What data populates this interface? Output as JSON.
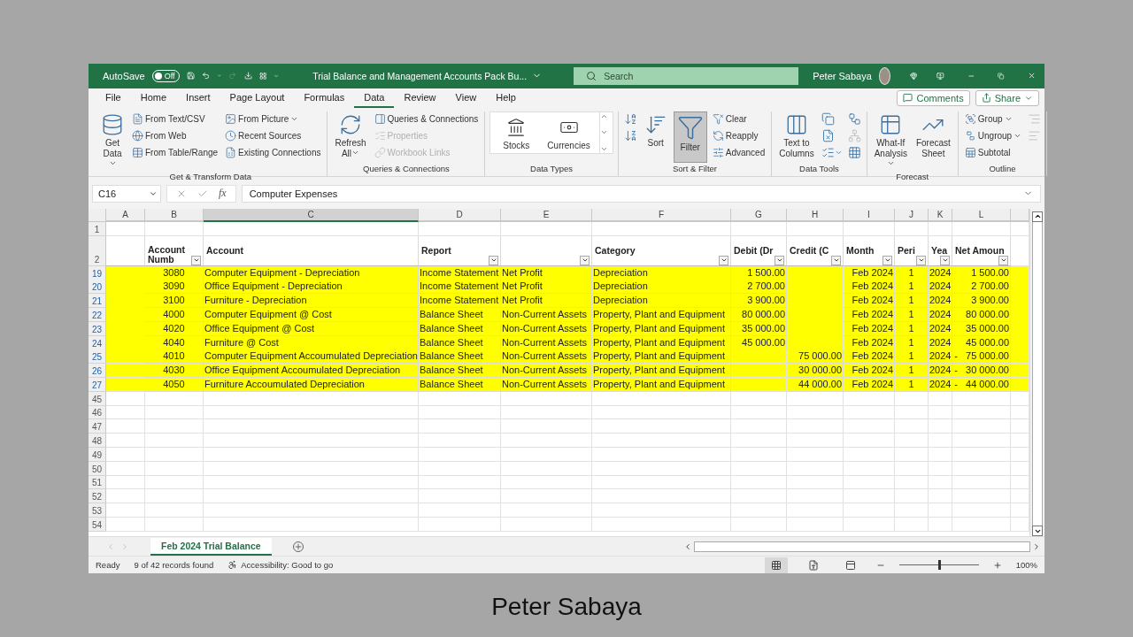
{
  "title_bar": {
    "autosave_label": "AutoSave",
    "autosave": {
      "label": "Off",
      "on": false
    },
    "document_title": "Trial Balance and Management Accounts Pack Bu...",
    "search": {
      "placeholder": "Search"
    },
    "user_name": "Peter Sabaya"
  },
  "ribbon_tabs": [
    {
      "label": "File",
      "selected": false
    },
    {
      "label": "Home",
      "selected": false
    },
    {
      "label": "Insert",
      "selected": false
    },
    {
      "label": "Page Layout",
      "selected": false
    },
    {
      "label": "Formulas",
      "selected": false
    },
    {
      "label": "Data",
      "selected": true
    },
    {
      "label": "Review",
      "selected": false
    },
    {
      "label": "View",
      "selected": false
    },
    {
      "label": "Help",
      "selected": false
    }
  ],
  "ribbon_buttons": {
    "comments": "Comments",
    "share": "Share"
  },
  "ribbon_groups": [
    {
      "label": "Get & Transform Data",
      "columns": [
        [
          {
            "kind": "large",
            "label": "Get Data",
            "caret": true
          }
        ],
        [
          {
            "kind": "small",
            "label": "From Text/CSV"
          },
          {
            "kind": "small",
            "label": "From Web"
          },
          {
            "kind": "small",
            "label": "From Table/Range"
          }
        ],
        [
          {
            "kind": "small",
            "label": "From Picture",
            "caret": true
          },
          {
            "kind": "small",
            "label": "Recent Sources"
          },
          {
            "kind": "small",
            "label": "Existing Connections"
          }
        ]
      ]
    },
    {
      "label": "Queries & Connections",
      "columns": [
        [
          {
            "kind": "large",
            "label": "Refresh All",
            "caret": true
          }
        ],
        [
          {
            "kind": "small",
            "label": "Queries & Connections"
          },
          {
            "kind": "small",
            "label": "Properties",
            "disabled": true
          },
          {
            "kind": "small",
            "label": "Workbook Links",
            "disabled": true
          }
        ]
      ]
    },
    {
      "label": "Data Types",
      "columns": [
        [
          {
            "kind": "tile",
            "label": "Stocks"
          }
        ],
        [
          {
            "kind": "tile",
            "label": "Currencies"
          }
        ]
      ]
    },
    {
      "label": "Sort & Filter",
      "columns": [
        [
          {
            "kind": "icon"
          },
          {
            "kind": "icon"
          }
        ],
        [
          {
            "kind": "large",
            "label": "Sort"
          }
        ],
        [
          {
            "kind": "large",
            "label": "Filter",
            "selected": true
          }
        ],
        [
          {
            "kind": "small",
            "label": "Clear"
          },
          {
            "kind": "small",
            "label": "Reapply"
          },
          {
            "kind": "small",
            "label": "Advanced"
          }
        ]
      ]
    },
    {
      "label": "Data Tools",
      "columns": [
        [
          {
            "kind": "large",
            "label": "Text to Columns"
          }
        ],
        [
          {
            "kind": "icon"
          },
          {
            "kind": "icon"
          },
          {
            "kind": "icon",
            "caret": true
          }
        ],
        [
          {
            "kind": "icon"
          },
          {
            "kind": "icon",
            "disabled": true
          },
          {
            "kind": "icon"
          }
        ]
      ]
    },
    {
      "label": "Forecast",
      "columns": [
        [
          {
            "kind": "large",
            "label": "What-If Analysis",
            "caret": true
          }
        ],
        [
          {
            "kind": "large",
            "label": "Forecast Sheet"
          }
        ]
      ]
    },
    {
      "label": "Outline",
      "columns": [
        [
          {
            "kind": "small",
            "label": "Group",
            "caret": true
          },
          {
            "kind": "small",
            "label": "Ungroup",
            "caret": true
          },
          {
            "kind": "small",
            "label": "Subtotal"
          }
        ],
        [
          {
            "kind": "icon",
            "disabled": true
          },
          {
            "kind": "icon",
            "disabled": true
          }
        ]
      ]
    }
  ],
  "formula_bar": {
    "name_box": "C16",
    "function_label": "fx",
    "formula": "Computer Expenses"
  },
  "columns": [
    {
      "label": "A",
      "selected": false
    },
    {
      "label": "B",
      "selected": false
    },
    {
      "label": "C",
      "selected": true
    },
    {
      "label": "D",
      "selected": false
    },
    {
      "label": "E",
      "selected": false
    },
    {
      "label": "F",
      "selected": false
    },
    {
      "label": "G",
      "selected": false
    },
    {
      "label": "H",
      "selected": false
    },
    {
      "label": "I",
      "selected": false
    },
    {
      "label": "J",
      "selected": false
    },
    {
      "label": "K",
      "selected": false
    },
    {
      "label": "L",
      "selected": false
    }
  ],
  "top_rows": [
    {
      "row_number": "1"
    }
  ],
  "header_row": {
    "row_number": "2",
    "cells": [
      {
        "filter": false
      },
      {
        "text": "Account Numb",
        "filter": true
      },
      {
        "text": "Account",
        "filter": false
      },
      {
        "text": "Report",
        "filter": true
      },
      {
        "filter": true
      },
      {
        "text": "Category",
        "filter": true
      },
      {
        "text": "Debit (Dr",
        "filter": true
      },
      {
        "text": "Credit (C",
        "filter": true
      },
      {
        "text": "Month",
        "filter": true
      },
      {
        "text": "Peri",
        "filter": true
      },
      {
        "text": "Yea",
        "filter": true
      },
      {
        "text": "Net Amoun",
        "filter": true
      }
    ]
  },
  "rows": [
    {
      "row_number": "19",
      "highlighted": true,
      "cells": [
        null,
        "3080",
        "Computer Equipment - Depreciation",
        "Income Statement",
        "Net Profit",
        "Depreciation",
        "1 500.00",
        null,
        "Feb 2024",
        "1",
        "2024",
        "1 500.00"
      ]
    },
    {
      "row_number": "20",
      "highlighted": true,
      "cells": [
        null,
        "3090",
        "Office Equipment - Depreciation",
        "Income Statement",
        "Net Profit",
        "Depreciation",
        "2 700.00",
        null,
        "Feb 2024",
        "1",
        "2024",
        "2 700.00"
      ]
    },
    {
      "row_number": "21",
      "highlighted": true,
      "cells": [
        null,
        "3100",
        "Furniture - Depreciation",
        "Income Statement",
        "Net Profit",
        "Depreciation",
        "3 900.00",
        null,
        "Feb 2024",
        "1",
        "2024",
        "3 900.00"
      ]
    },
    {
      "row_number": "22",
      "highlighted": true,
      "cells": [
        null,
        "4000",
        "Computer Equipment @ Cost",
        "Balance Sheet",
        "Non-Current Assets",
        "Property, Plant and Equipment",
        "80 000.00",
        null,
        "Feb 2024",
        "1",
        "2024",
        "80 000.00"
      ]
    },
    {
      "row_number": "23",
      "highlighted": true,
      "cells": [
        null,
        "4020",
        "Office Equipment @ Cost",
        "Balance Sheet",
        "Non-Current Assets",
        "Property, Plant and Equipment",
        "35 000.00",
        null,
        "Feb 2024",
        "1",
        "2024",
        "35 000.00"
      ]
    },
    {
      "row_number": "24",
      "highlighted": true,
      "cells": [
        null,
        "4040",
        "Furniture @ Cost",
        "Balance Sheet",
        "Non-Current Assets",
        "Property, Plant and Equipment",
        "45 000.00",
        null,
        "Feb 2024",
        "1",
        "2024",
        "45 000.00"
      ]
    },
    {
      "row_number": "25",
      "highlighted": true,
      "cells": [
        null,
        "4010",
        "Computer Equipment Accoumulated Depreciation",
        "Balance Sheet",
        "Non-Current Assets",
        "Property, Plant and Equipment",
        null,
        "75 000.00",
        "Feb 2024",
        "1",
        "2024",
        "-   75 000.00"
      ]
    },
    {
      "row_number": "26",
      "highlighted": true,
      "cells": [
        null,
        "4030",
        "Office Equipment Accoumulated Depreciation",
        "Balance Sheet",
        "Non-Current Assets",
        "Property, Plant and Equipment",
        null,
        "30 000.00",
        "Feb 2024",
        "1",
        "2024",
        "-   30 000.00"
      ]
    },
    {
      "row_number": "27",
      "highlighted": true,
      "cells": [
        null,
        "4050",
        "Furniture Accoumulated Depreciation",
        "Balance Sheet",
        "Non-Current Assets",
        "Property, Plant and Equipment",
        null,
        "44 000.00",
        "Feb 2024",
        "1",
        "2024",
        "-   44 000.00"
      ]
    },
    {
      "row_number": "45",
      "highlighted": false,
      "cells": []
    },
    {
      "row_number": "46",
      "highlighted": false,
      "cells": []
    },
    {
      "row_number": "47",
      "highlighted": false,
      "cells": []
    },
    {
      "row_number": "48",
      "highlighted": false,
      "cells": []
    },
    {
      "row_number": "49",
      "highlighted": false,
      "cells": []
    },
    {
      "row_number": "50",
      "highlighted": false,
      "cells": []
    },
    {
      "row_number": "51",
      "highlighted": false,
      "cells": []
    },
    {
      "row_number": "52",
      "highlighted": false,
      "cells": []
    },
    {
      "row_number": "53",
      "highlighted": false,
      "cells": []
    },
    {
      "row_number": "54",
      "highlighted": false,
      "cells": []
    }
  ],
  "sheet_tabs": [
    {
      "label": "Feb 2024 Trial Balance",
      "selected": true
    }
  ],
  "status_bar": {
    "mode": "Ready",
    "records": "9 of 42 records found",
    "accessibility": "Accessibility: Good to go",
    "views": [
      {
        "selected": true
      },
      {
        "selected": false
      },
      {
        "selected": false
      }
    ],
    "zoom": {
      "level": 0.5,
      "reading": "100%"
    }
  },
  "caption": "Peter Sabaya"
}
